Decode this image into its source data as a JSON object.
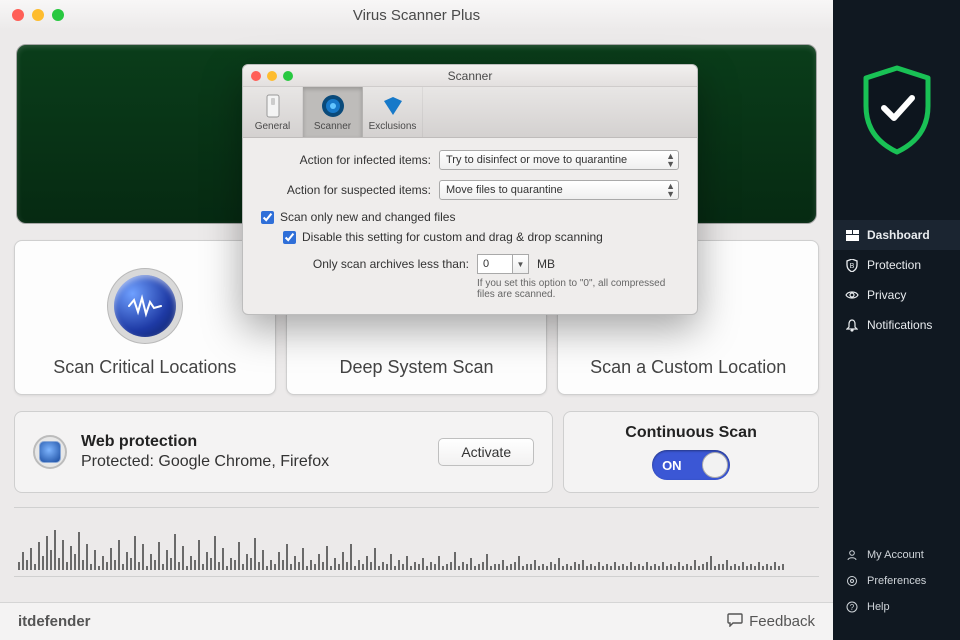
{
  "app": {
    "title": "Virus Scanner Plus"
  },
  "dialog": {
    "title": "Scanner",
    "tabs": {
      "general": "General",
      "scanner": "Scanner",
      "exclusions": "Exclusions"
    },
    "infected_label": "Action for infected items:",
    "infected_value": "Try to disinfect or move to quarantine",
    "suspected_label": "Action for suspected items:",
    "suspected_value": "Move files to quarantine",
    "chk_new_changed": "Scan only new and changed files",
    "chk_disable_custom": "Disable this setting for custom and drag & drop scanning",
    "archive_label": "Only scan archives less than:",
    "archive_value": "0",
    "archive_unit": "MB",
    "archive_hint": "If you set this option to \"0\", all compressed files are scanned."
  },
  "cards": {
    "critical": "Scan Critical Locations",
    "deep": "Deep System Scan",
    "custom": "Scan a Custom Location"
  },
  "web": {
    "title": "Web protection",
    "subtitle": "Protected: Google Chrome, Firefox",
    "activate": "Activate"
  },
  "continuous": {
    "title": "Continuous Scan",
    "state": "ON"
  },
  "footer": {
    "brand": "itdefender",
    "feedback": "Feedback"
  },
  "sidebar": {
    "dashboard": "Dashboard",
    "protection": "Protection",
    "privacy": "Privacy",
    "notifications": "Notifications",
    "account": "My Account",
    "preferences": "Preferences",
    "help": "Help"
  }
}
